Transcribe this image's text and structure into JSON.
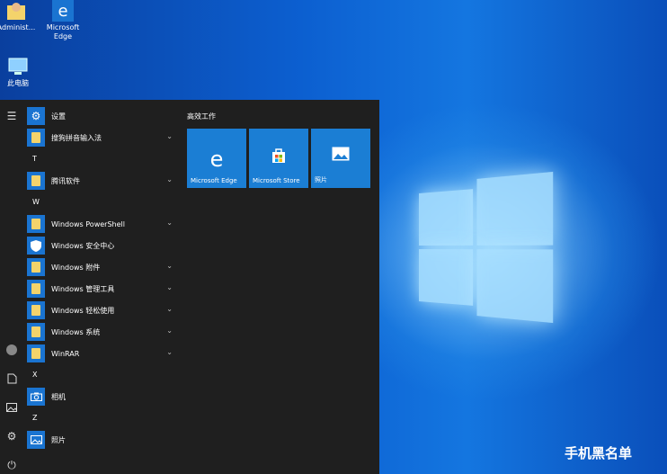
{
  "desktop": {
    "icons": [
      {
        "label": "Administ...",
        "icon": "user-folder-icon"
      },
      {
        "label": "Microsoft Edge",
        "icon": "edge-icon"
      },
      {
        "label": "此电脑",
        "icon": "computer-icon"
      }
    ]
  },
  "start_menu": {
    "rail": [
      "hamburger-menu-icon",
      "user-avatar-icon",
      "documents-icon",
      "pictures-icon",
      "settings-icon",
      "power-icon"
    ],
    "apps": [
      {
        "type": "app",
        "label": "设置",
        "icon": "gear-icon",
        "expandable": false
      },
      {
        "type": "app",
        "label": "搜狗拼音输入法",
        "icon": "folder-icon",
        "expandable": true
      },
      {
        "type": "letter",
        "label": "T"
      },
      {
        "type": "app",
        "label": "腾讯软件",
        "icon": "folder-icon",
        "expandable": true
      },
      {
        "type": "letter",
        "label": "W"
      },
      {
        "type": "app",
        "label": "Windows PowerShell",
        "icon": "folder-icon",
        "expandable": true
      },
      {
        "type": "app",
        "label": "Windows 安全中心",
        "icon": "shield-icon",
        "expandable": false
      },
      {
        "type": "app",
        "label": "Windows 附件",
        "icon": "folder-icon",
        "expandable": true
      },
      {
        "type": "app",
        "label": "Windows 管理工具",
        "icon": "folder-icon",
        "expandable": true
      },
      {
        "type": "app",
        "label": "Windows 轻松使用",
        "icon": "folder-icon",
        "expandable": true
      },
      {
        "type": "app",
        "label": "Windows 系统",
        "icon": "folder-icon",
        "expandable": true
      },
      {
        "type": "app",
        "label": "WinRAR",
        "icon": "folder-icon",
        "expandable": true
      },
      {
        "type": "letter",
        "label": "X"
      },
      {
        "type": "app",
        "label": "相机",
        "icon": "camera-icon",
        "expandable": false
      },
      {
        "type": "letter",
        "label": "Z"
      },
      {
        "type": "app",
        "label": "照片",
        "icon": "photos-icon",
        "expandable": false
      }
    ],
    "tile_group": {
      "title": "高效工作",
      "tiles": [
        {
          "label": "Microsoft Edge",
          "icon": "edge-icon"
        },
        {
          "label": "Microsoft Store",
          "icon": "store-icon"
        },
        {
          "label": "照片",
          "icon": "photos-icon"
        }
      ]
    }
  },
  "watermark": "手机黑名单",
  "colors": {
    "tile": "#1b7ed4",
    "start_bg": "#1f1f1f",
    "folder": "#f4d36b"
  }
}
